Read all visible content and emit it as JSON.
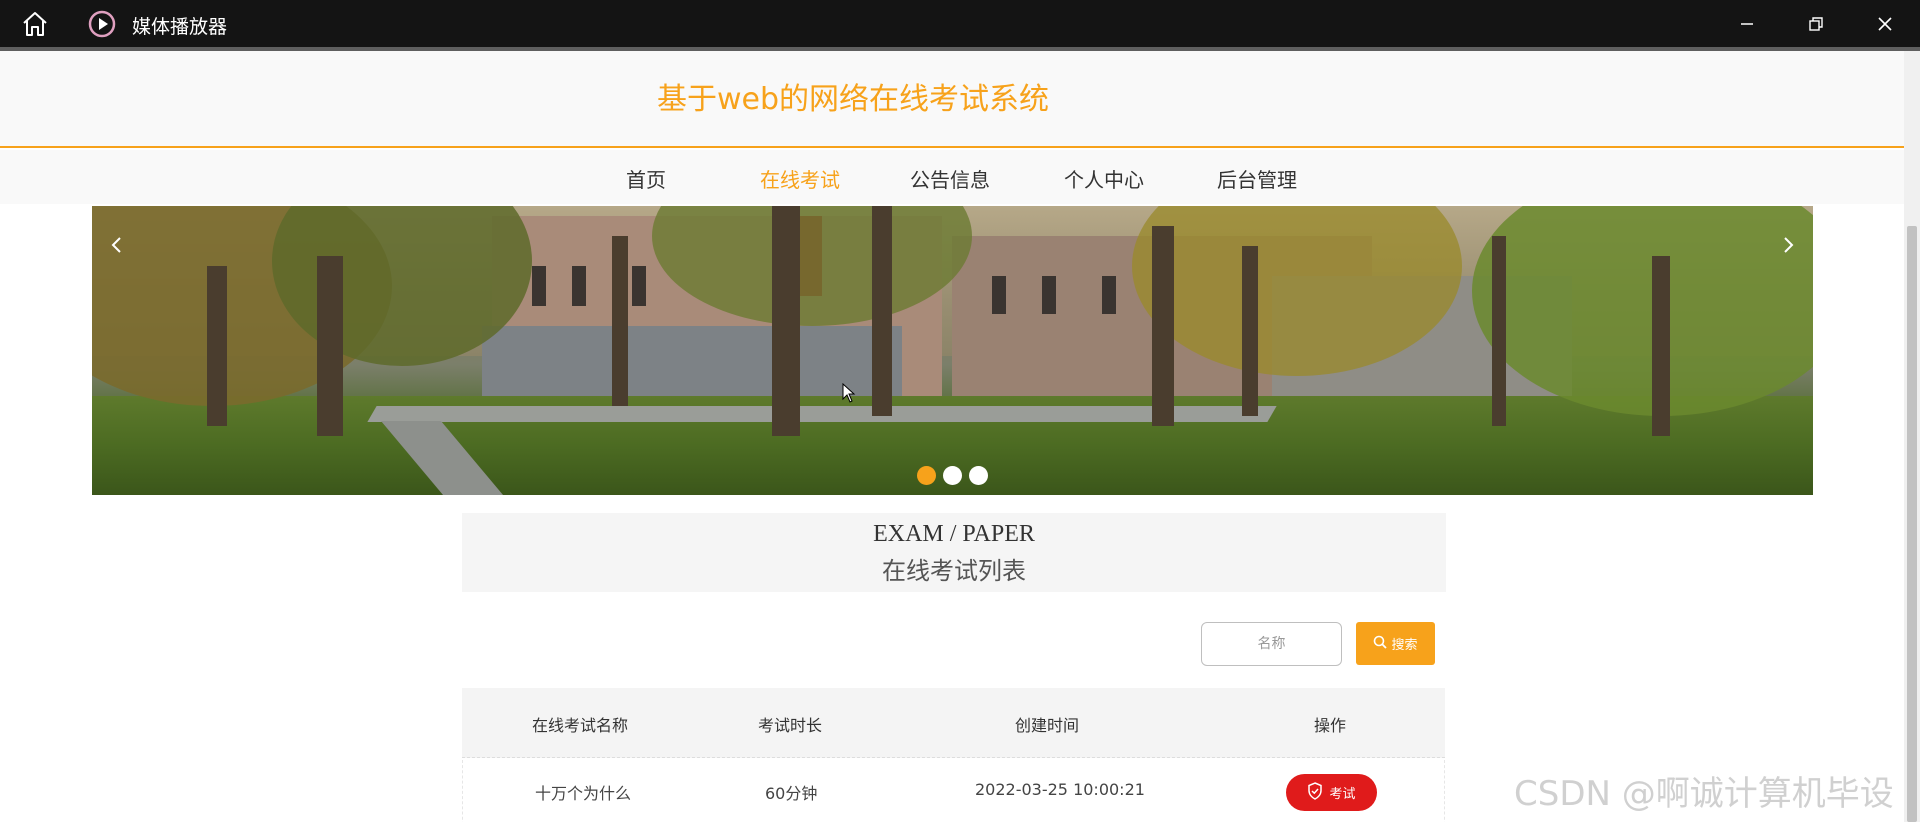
{
  "window": {
    "title": "媒体播放器"
  },
  "site": {
    "title": "基于web的网络在线考试系统"
  },
  "nav": {
    "items": [
      {
        "label": "首页",
        "active": false
      },
      {
        "label": "在线考试",
        "active": true
      },
      {
        "label": "公告信息",
        "active": false
      },
      {
        "label": "个人中心",
        "active": false
      },
      {
        "label": "后台管理",
        "active": false
      }
    ]
  },
  "banner": {
    "slides": 3,
    "active_slide": 1
  },
  "section": {
    "title_en": "EXAM / PAPER",
    "title_cn": "在线考试列表"
  },
  "search": {
    "placeholder": "名称",
    "button_label": "搜索"
  },
  "table": {
    "columns": [
      "在线考试名称",
      "考试时长",
      "创建时间",
      "操作"
    ],
    "rows": [
      {
        "name": "十万个为什么",
        "duration": "60分钟",
        "created": "2022-03-25 10:00:21",
        "action": "考试"
      }
    ]
  },
  "watermark": "CSDN @啊诚计算机毕设",
  "colors": {
    "accent": "#f7a21b",
    "exam_button": "#e01b1b",
    "titlebar": "#141414"
  }
}
